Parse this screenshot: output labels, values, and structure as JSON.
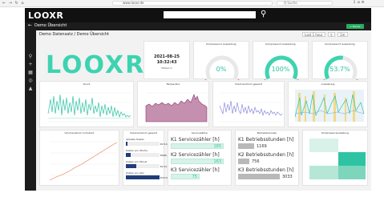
{
  "browser": {
    "nav_glyphs": "← → ↻ ⌂",
    "url": "www.looxr.de",
    "search_placeholder": "Q Suche",
    "right_glyphs": "⇩ ⌂ ≡"
  },
  "app": {
    "logo": "LOOXR",
    "search_icon": "search-icon"
  },
  "dashboard": {
    "back_glyph": "←",
    "title": "Demo Übersicht",
    "add_button": "+ Neues",
    "breadcrumb": "Demo Datensatz / Demo Übersicht",
    "toolbar_items": [
      "Last 1 hour",
      "1m"
    ]
  },
  "sidebar": {
    "icons": [
      "search-icon",
      "plus-icon",
      "grid-icon",
      "compass-icon",
      "bell-icon"
    ]
  },
  "brand_logo": "LOOXR",
  "clock": {
    "date": "2021-08-25",
    "time": "10:32:43",
    "sub": "Mittwoch"
  },
  "gauges": [
    {
      "title": "Kompressor1 Auslastung",
      "value": "0%",
      "level": 0
    },
    {
      "title": "Kompressor2 Auslastung",
      "value": "100%",
      "level": 100
    },
    {
      "title": "Kompressor3 Auslastung",
      "value": "53.7%",
      "level": 53.7
    }
  ],
  "panels": {
    "druck": "Druck",
    "temperatur": "Temperatur",
    "volumenstrom": "Volumenstrom gesamt",
    "auslastung": "Auslastung",
    "volumenstrom_kumuliert": "Volumenstrom kumuliert",
    "kosten": "Volumenstrom gesamt",
    "servicezaehler": "Servicezähler",
    "betriebsstunden": "Betriebsstunden",
    "kompressorauslastung": "Kompressorauslastung"
  },
  "costs": [
    {
      "label": "aktuelle Kosten",
      "value": "€15.6",
      "level": 0.05
    },
    {
      "label": "Kosten pro Woche",
      "value": "€686.3",
      "level": 0.15
    },
    {
      "label": "Kosten pro Monat",
      "value": "€2.1k",
      "level": 0.3
    },
    {
      "label": "Kosten pro Jahr",
      "value": "€32.0k",
      "level": 1.0
    }
  ],
  "service": [
    {
      "label": "K1 Servicezähler [h]",
      "value": "165"
    },
    {
      "label": "K2 Servicezähler [h]",
      "value": "163"
    },
    {
      "label": "K3 Servicezähler [h]",
      "value": "75"
    }
  ],
  "operating_hours": [
    {
      "label": "K1 Betriebsstunden [h]",
      "value": "1169"
    },
    {
      "label": "K2 Betriebsstunden [h]",
      "value": "756"
    },
    {
      "label": "K3 Betriebsstunden [h]",
      "value": "3033"
    }
  ],
  "colors": {
    "accent": "#3ed3b0",
    "header": "#111111",
    "druck_line": "#2ec4a3",
    "temp_fill": "#8c3a6b",
    "vol_line": "#7b7fd6",
    "cumulative": "#f0a080"
  }
}
